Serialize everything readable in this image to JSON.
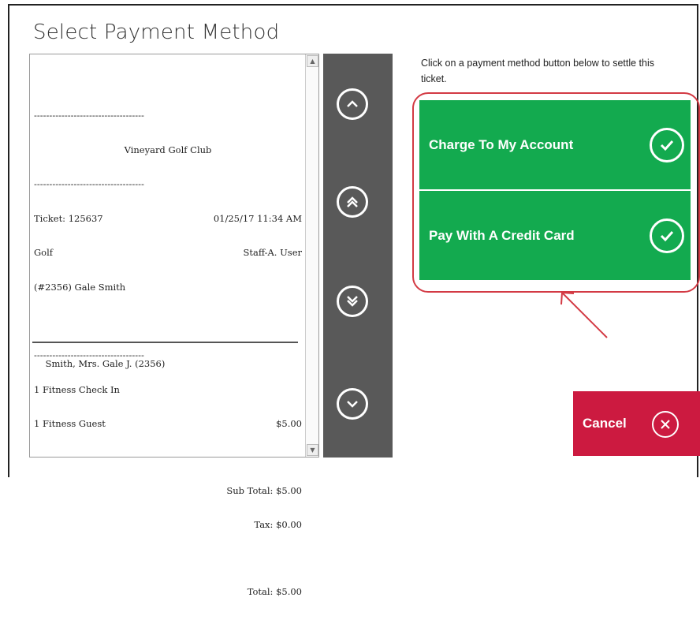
{
  "dialog": {
    "title": "Select Payment Method"
  },
  "receipt": {
    "dashes": "------------------------------------",
    "club_name": "Vineyard Golf Club",
    "ticket_label": "Ticket: 125637",
    "ticket_datetime": "01/25/17 11:34 AM",
    "department": "Golf",
    "staff": "Staff-A. User",
    "member": "(#2356) Gale Smith",
    "items": [
      {
        "name": "1 Fitness Check In",
        "price": ""
      },
      {
        "name": "1 Fitness Guest",
        "price": "$5.00"
      }
    ],
    "subtotal": "Sub Total: $5.00",
    "tax": "Tax: $0.00",
    "total": "Total: $5.00",
    "signature_name": "Smith, Mrs. Gale J. (2356)"
  },
  "navigation": {
    "icons": [
      "chevron-up-icon",
      "double-chevron-up-icon",
      "double-chevron-down-icon",
      "chevron-down-icon"
    ]
  },
  "instruction": "Click on a payment method button below to settle this ticket.",
  "payment_options": [
    {
      "label": "Charge To My Account",
      "icon": "check-circle-icon"
    },
    {
      "label": "Pay With A Credit Card",
      "icon": "check-circle-icon"
    }
  ],
  "cancel": {
    "label": "Cancel",
    "icon": "close-circle-icon"
  },
  "colors": {
    "green": "#13aa4f",
    "red": "#cc1a40",
    "nav_bg": "#595959",
    "highlight": "#d33a44"
  }
}
